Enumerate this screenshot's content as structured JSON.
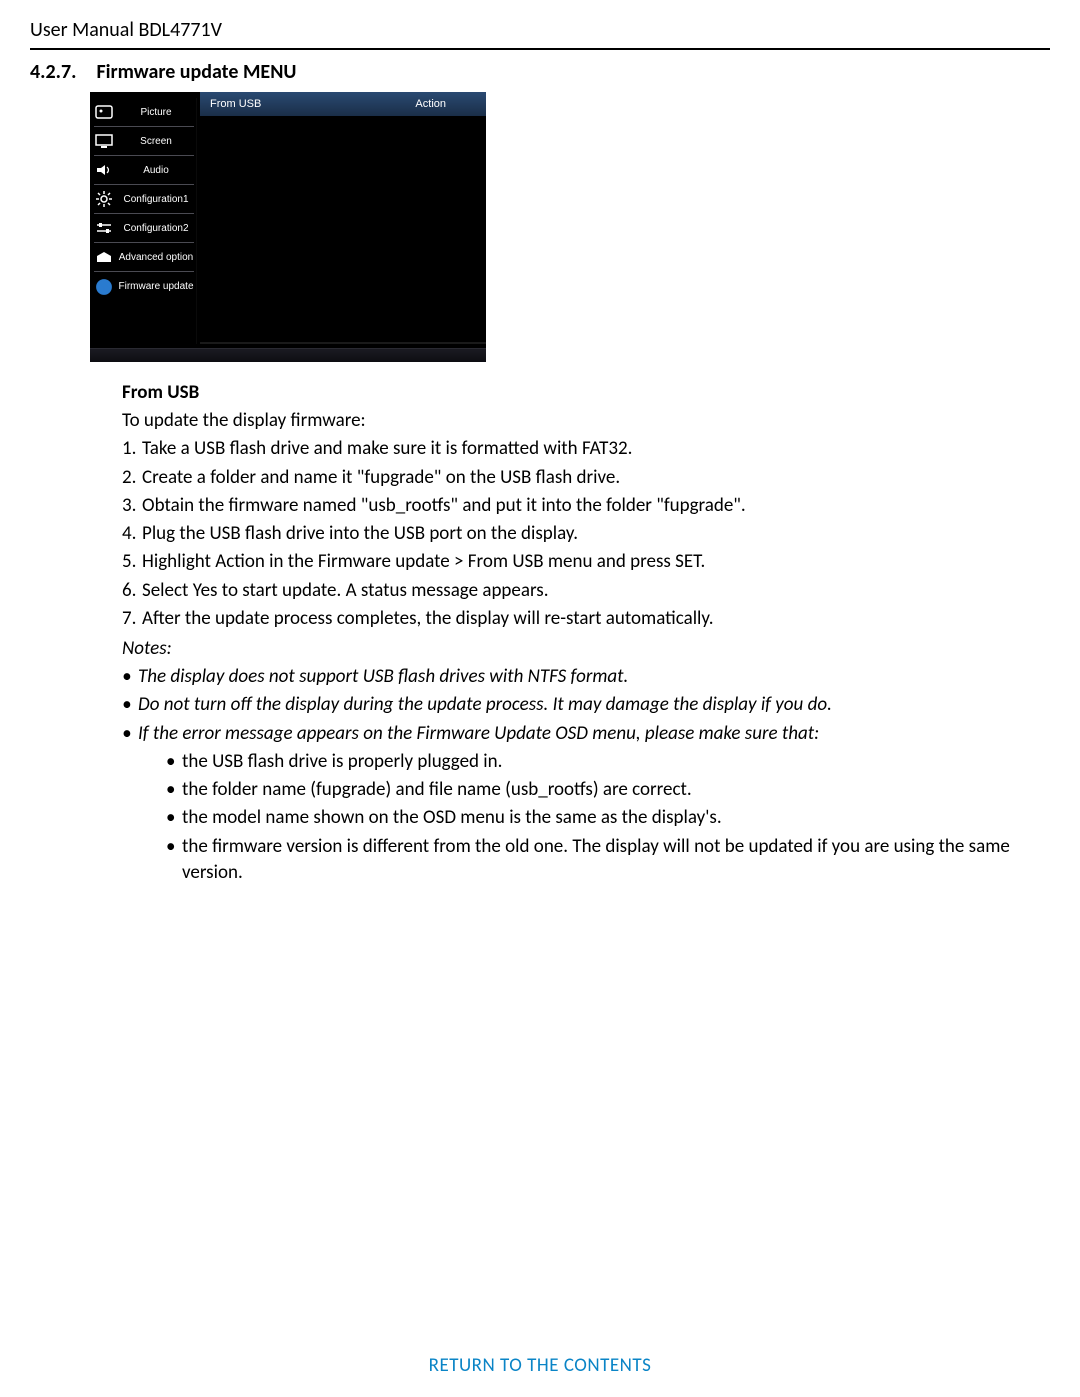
{
  "header": "User Manual BDL4771V",
  "section": {
    "number": "4.2.7.",
    "title": "Firmware update MENU"
  },
  "osd": {
    "sidebar": [
      {
        "label": "Picture",
        "icon": "picture"
      },
      {
        "label": "Screen",
        "icon": "screen"
      },
      {
        "label": "Audio",
        "icon": "audio"
      },
      {
        "label": "Configuration1",
        "icon": "gear"
      },
      {
        "label": "Configuration2",
        "icon": "sliders"
      },
      {
        "label": "Advanced option",
        "icon": "advanced"
      },
      {
        "label": "Firmware update",
        "icon": "update",
        "selected": true
      }
    ],
    "main": {
      "left": "From USB",
      "right": "Action"
    }
  },
  "subhead": "From USB",
  "intro": "To update the display firmware:",
  "steps": [
    "Take a USB flash drive and make sure it is formatted with FAT32.",
    "Create a folder and name it \"fupgrade\" on the USB flash drive.",
    "Obtain the firmware named \"usb_rootfs\" and put it into the folder \"fupgrade\".",
    "Plug the USB flash drive into the USB port on the display.",
    "Highlight Action in the Firmware update > From USB menu and press SET.",
    "Select Yes to start update. A status message appears.",
    "After the update process completes, the display will re-start automatically."
  ],
  "notes_label": "Notes:",
  "notes": [
    "The display does not support USB flash drives with NTFS format.",
    "Do not turn off the display during the update process. It may damage the display if you do.",
    "If the error message appears on the Firmware Update OSD menu, please make sure that:"
  ],
  "subnotes": [
    "the USB flash drive is properly plugged in.",
    "the folder name (fupgrade) and file name (usb_rootfs) are correct.",
    "the model name shown on the OSD menu is the same as the display's.",
    "the firmware version is different from the old one. The display will not be updated if you are using the same version."
  ],
  "return_link": "RETURN TO THE CONTENTS"
}
